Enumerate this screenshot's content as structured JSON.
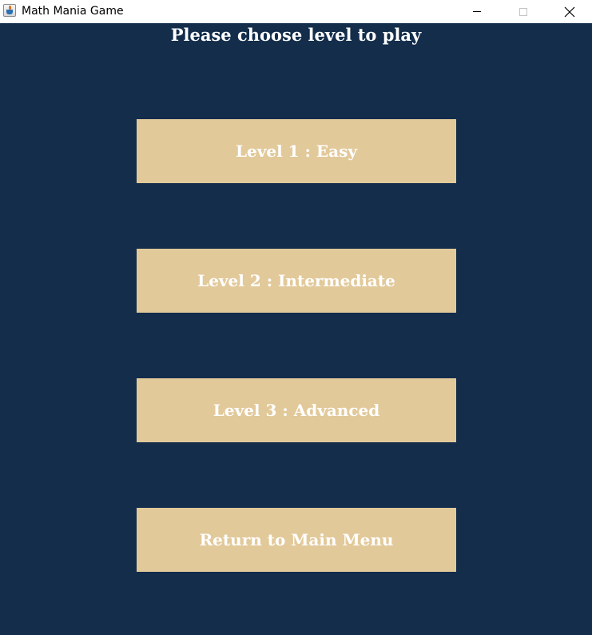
{
  "window": {
    "title": "Math Mania Game",
    "app_icon": "java-cup-icon"
  },
  "heading": "Please choose level to play",
  "buttons": {
    "level1": "Level 1 : Easy",
    "level2": "Level 2 : Intermediate",
    "level3": "Level 3 : Advanced",
    "main_menu": "Return to Main Menu"
  },
  "colors": {
    "background": "#132d4b",
    "button": "#e2c99a",
    "button_text": "#ffffff"
  }
}
